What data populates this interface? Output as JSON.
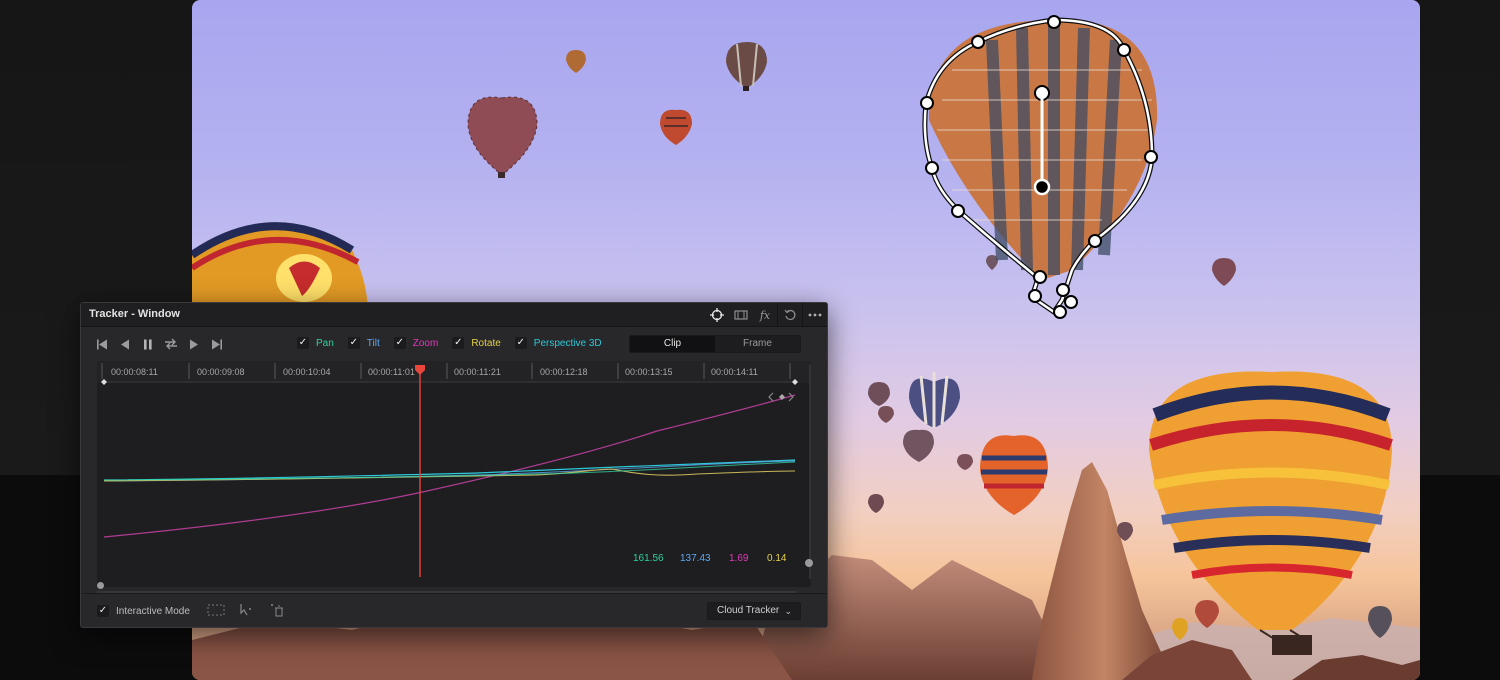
{
  "tracker": {
    "title": "Tracker - Window",
    "title_icons": [
      "crosshair-icon",
      "film-icon",
      "fx-icon",
      "reset-icon",
      "more-icon"
    ],
    "transport": [
      "skip-to-start-icon",
      "step-back-icon",
      "pause-icon",
      "loop-icon",
      "play-icon",
      "skip-to-end-icon"
    ],
    "checks": [
      {
        "label": "Pan",
        "checked": true,
        "color": "#2fd1a0"
      },
      {
        "label": "Tilt",
        "checked": true,
        "color": "#5ea8f0"
      },
      {
        "label": "Zoom",
        "checked": true,
        "color": "#e23ab9"
      },
      {
        "label": "Rotate",
        "checked": true,
        "color": "#e5d04a"
      },
      {
        "label": "Perspective 3D",
        "checked": true,
        "color": "#2bc9d9"
      }
    ],
    "segment": {
      "clip": "Clip",
      "frame": "Frame",
      "selected": "Clip"
    },
    "timecodes": [
      "00:00:08:11",
      "00:00:09:08",
      "00:00:10:04",
      "00:00:11:01",
      "00:00:11:21",
      "00:00:12:18",
      "00:00:13:15",
      "00:00:14:11"
    ],
    "playhead_timecode_index": 3,
    "readouts": [
      {
        "value": "161.56",
        "color": "#2fd1a0"
      },
      {
        "value": "137.43",
        "color": "#5ea8f0"
      },
      {
        "value": "1.69",
        "color": "#e23ab9"
      },
      {
        "value": "0.14",
        "color": "#e5d04a"
      }
    ],
    "footer": {
      "interactive_mode_label": "Interactive Mode",
      "interactive_mode_checked": true,
      "tracker_type": "Cloud Tracker"
    }
  },
  "colors": {
    "playhead": "#e8463a",
    "accent_pan": "#2fd1a0",
    "accent_tilt": "#5ea8f0",
    "accent_zoom": "#e23ab9",
    "accent_rotate": "#e5d04a",
    "accent_persp": "#2bc9d9"
  }
}
